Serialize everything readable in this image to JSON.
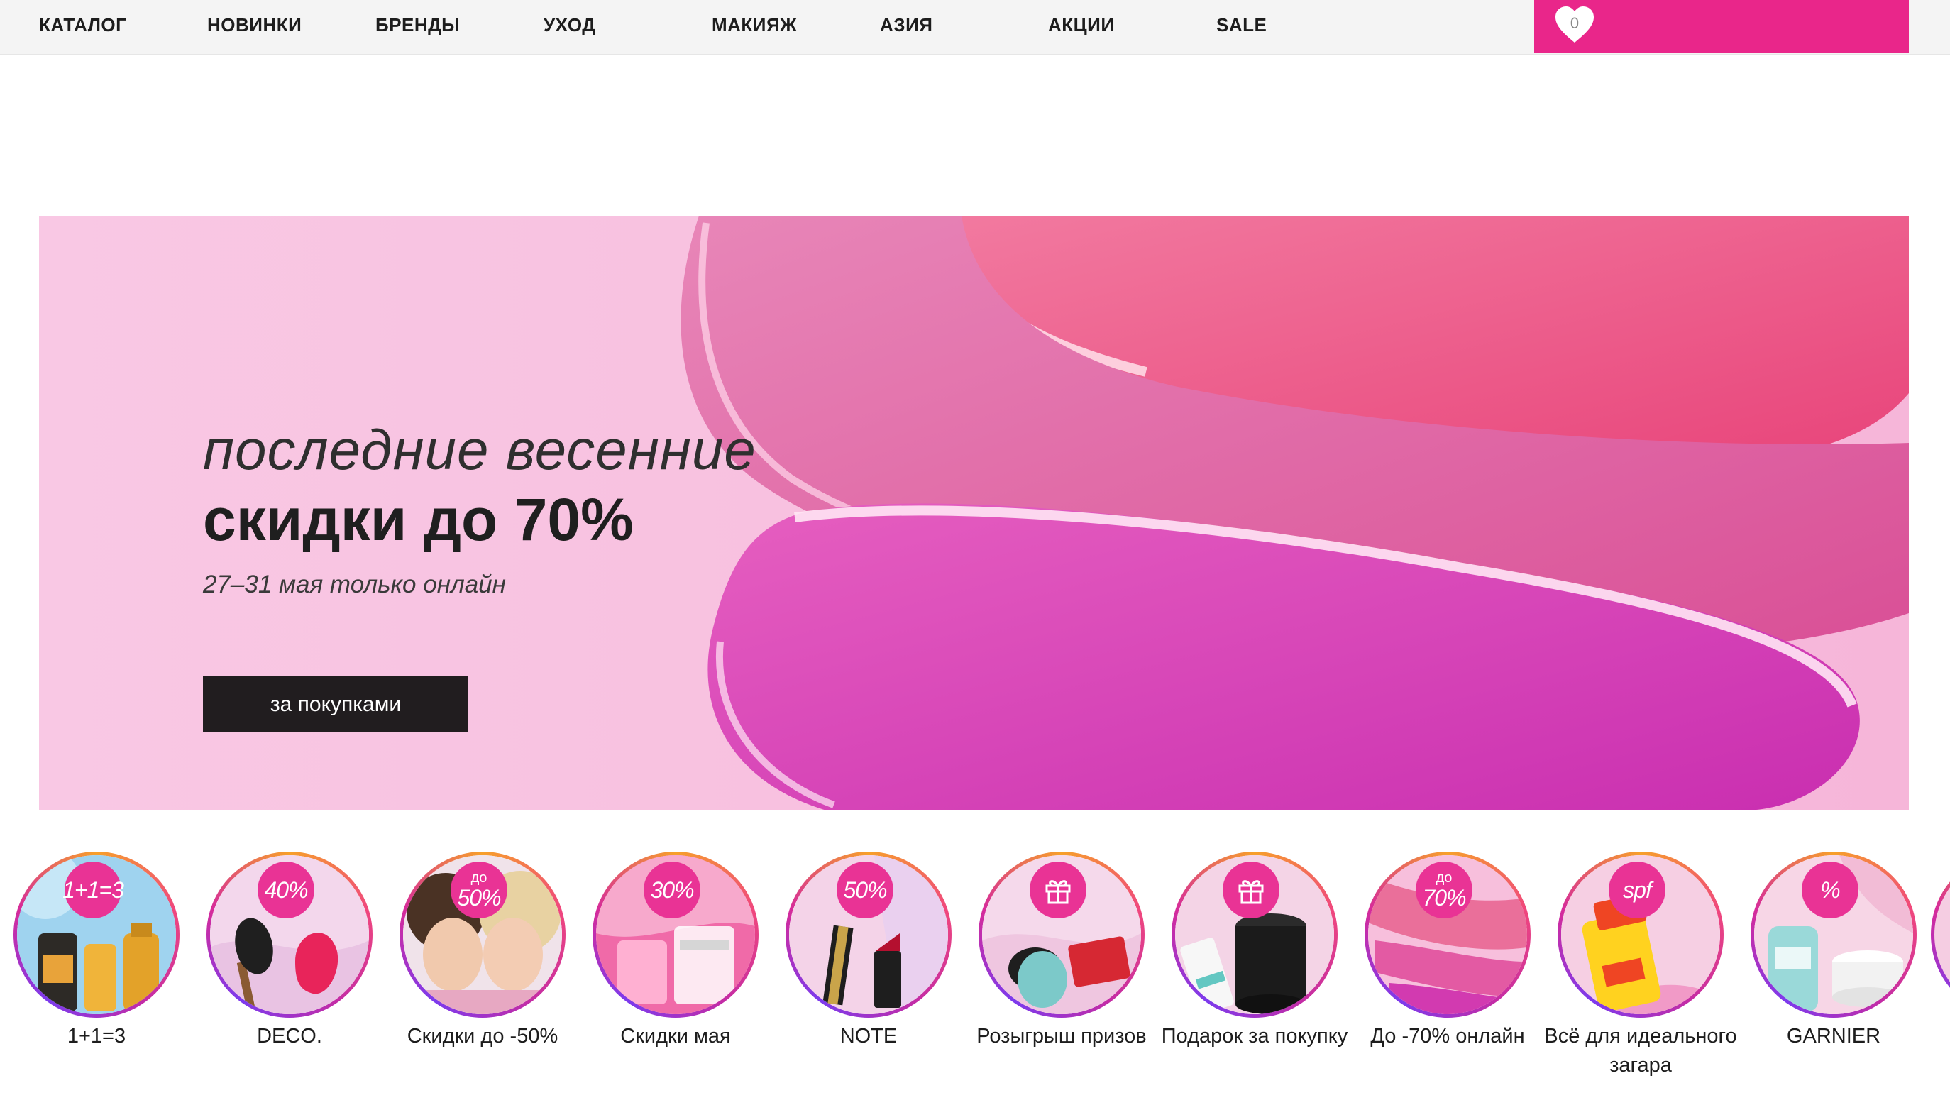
{
  "nav": {
    "items": [
      "КАТАЛОГ",
      "НОВИНКИ",
      "БРЕНДЫ",
      "УХОД",
      "МАКИЯЖ",
      "АЗИЯ",
      "АКЦИИ",
      "SALE"
    ],
    "wishlist_count": "0"
  },
  "hero": {
    "line1": "последние весенние",
    "line2": "скидки до 70%",
    "subtitle": "27–31 мая только онлайн",
    "button": "за покупками"
  },
  "stories": [
    {
      "badge": "1+1=3",
      "badge_small": "",
      "icon": "",
      "label": "1+1=3"
    },
    {
      "badge": "40%",
      "badge_small": "",
      "icon": "",
      "label": "DECO."
    },
    {
      "badge": "50%",
      "badge_small": "до",
      "icon": "",
      "label": "Скидки до -50%"
    },
    {
      "badge": "30%",
      "badge_small": "",
      "icon": "",
      "label": "Скидки мая"
    },
    {
      "badge": "50%",
      "badge_small": "",
      "icon": "",
      "label": "NOTE"
    },
    {
      "badge": "",
      "badge_small": "",
      "icon": "gift-icon",
      "label": "Розыгрыш призов"
    },
    {
      "badge": "",
      "badge_small": "",
      "icon": "gift-icon",
      "label": "Подарок за покупку"
    },
    {
      "badge": "70%",
      "badge_small": "до",
      "icon": "",
      "label": "До -70% онлайн"
    },
    {
      "badge": "spf",
      "badge_small": "",
      "icon": "",
      "label": "Всё для идеального загара"
    },
    {
      "badge": "%",
      "badge_small": "",
      "icon": "",
      "label": "GARNIER"
    }
  ],
  "colors": {
    "accent": "#e9268a",
    "hero_bg": "#f8c4e2",
    "button_bg": "#211d1f"
  }
}
